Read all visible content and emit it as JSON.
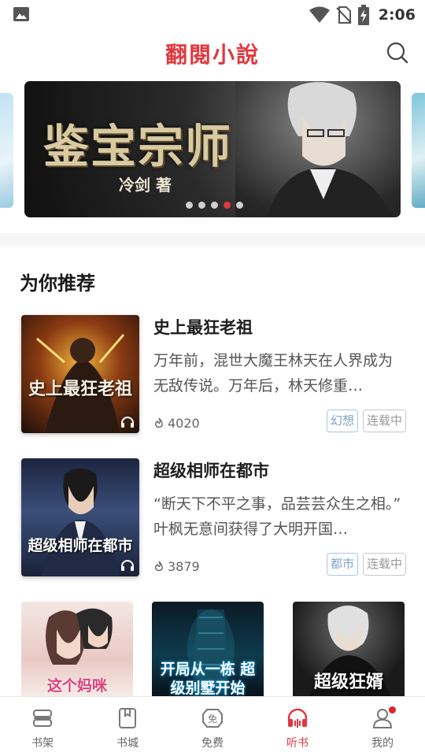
{
  "status_bar": {
    "time": "2:06"
  },
  "header": {
    "title": "翻閱小說"
  },
  "banner": {
    "title": "鉴宝宗师",
    "author": "冷剑 著",
    "dots_total": 5,
    "active_dot": 4
  },
  "section": {
    "title": "为你推荐"
  },
  "books": [
    {
      "title": "史上最狂老祖",
      "description": "万年前，混世大魔王林天在人界成为无敌传说。万年后，林天修重…",
      "count": "4020",
      "genre": "幻想",
      "status": "连载中",
      "cover_text": "史上最狂老祖"
    },
    {
      "title": "超级相师在都市",
      "description": "“断天下不平之事，品芸芸众生之相。” 叶枫无意间获得了大明开国…",
      "count": "3879",
      "genre": "都市",
      "status": "连载中",
      "cover_text": "超级相师在都市"
    }
  ],
  "more_covers": [
    {
      "cover_text": "这个妈咪"
    },
    {
      "cover_text": "开局从一栋 超级别墅开始"
    },
    {
      "cover_text": "超级狂婿"
    }
  ],
  "tabbar": {
    "items": [
      {
        "label": "书架",
        "icon": "bookshelf-icon"
      },
      {
        "label": "书城",
        "icon": "bookstore-icon"
      },
      {
        "label": "免费",
        "icon": "free-icon"
      },
      {
        "label": "听书",
        "icon": "headphones-icon"
      },
      {
        "label": "我的",
        "icon": "profile-icon"
      }
    ],
    "active_index": 3
  },
  "colors": {
    "accent": "#e0383e",
    "genre_tag": "#7aa3cf",
    "badge": "#e0242a"
  }
}
